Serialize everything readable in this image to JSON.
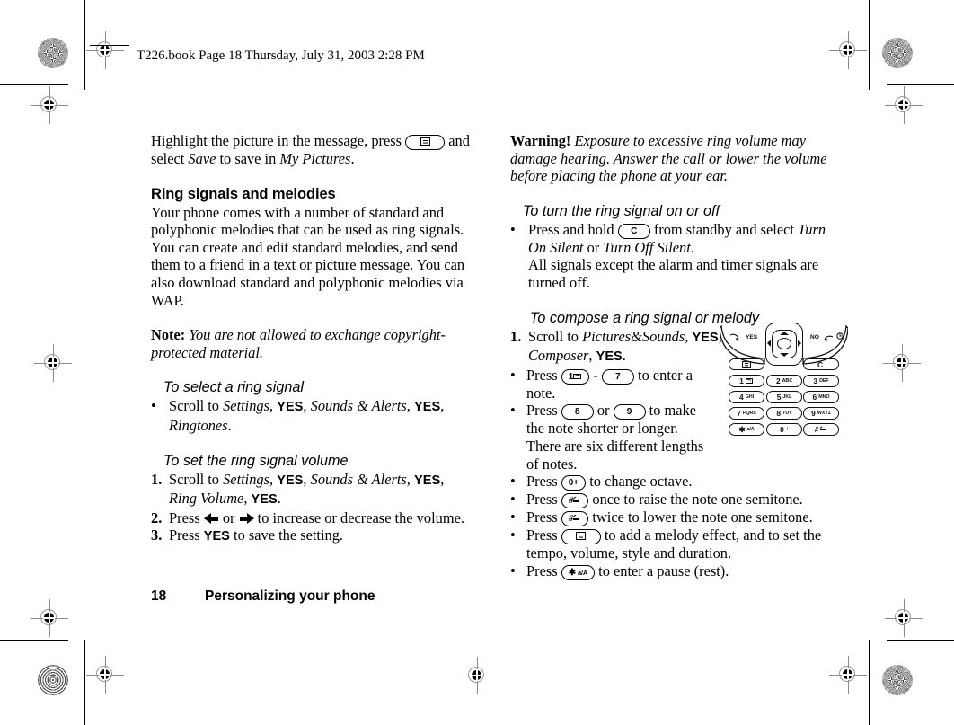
{
  "slug": {
    "text": "T226.book  Page 18  Thursday, July 31, 2003  2:28 PM"
  },
  "footer": {
    "page_number": "18",
    "chapter": "Personalizing your phone"
  },
  "left_column": {
    "intro": {
      "line1_a": "Highlight the picture in the message, press ",
      "key": "menu-key",
      "line1_b": " and",
      "line2_a": "select ",
      "line2_italic1": "Save",
      "line2_b": " to save in ",
      "line2_italic2": "My Pictures",
      "line2_c": "."
    },
    "section_heading": "Ring signals and melodies",
    "section_body": "Your phone comes with a number of standard and polyphonic melodies that can be used as ring signals. You can create and edit standard melodies, and send them to a friend in a text or picture message. You can also download standard and polyphonic melodies via WAP.",
    "note": {
      "label": "Note:",
      "text": "You are not allowed to exchange copyright-protected material."
    },
    "sub1": {
      "heading": "To select a ring signal",
      "marker": "•",
      "parts": [
        {
          "t": "Scroll to ",
          "style": "roman"
        },
        {
          "t": "Settings",
          "style": "italic"
        },
        {
          "t": ", ",
          "style": "roman"
        },
        {
          "t": "YES",
          "style": "bold-sans"
        },
        {
          "t": ", ",
          "style": "roman"
        },
        {
          "t": "Sounds & Alerts",
          "style": "italic"
        },
        {
          "t": ", ",
          "style": "roman"
        },
        {
          "t": "YES",
          "style": "bold-sans"
        },
        {
          "t": ", ",
          "style": "roman"
        },
        {
          "t": "Ringtones",
          "style": "italic"
        },
        {
          "t": ".",
          "style": "roman"
        }
      ]
    },
    "sub2": {
      "heading": "To set the ring signal volume",
      "steps": [
        {
          "marker": "1.",
          "parts": [
            {
              "t": "Scroll to ",
              "style": "roman"
            },
            {
              "t": "Settings",
              "style": "italic"
            },
            {
              "t": ", ",
              "style": "roman"
            },
            {
              "t": "YES",
              "style": "bold-sans"
            },
            {
              "t": ", ",
              "style": "roman"
            },
            {
              "t": "Sounds & Alerts",
              "style": "italic"
            },
            {
              "t": ", ",
              "style": "roman"
            },
            {
              "t": "YES",
              "style": "bold-sans"
            },
            {
              "t": ", ",
              "style": "roman"
            },
            {
              "t": "Ring Volume",
              "style": "italic"
            },
            {
              "t": ", ",
              "style": "roman"
            },
            {
              "t": "YES",
              "style": "bold-sans"
            },
            {
              "t": ".",
              "style": "roman"
            }
          ]
        },
        {
          "marker": "2.",
          "text_before": "Press ",
          "arrow_left": "left-arrow",
          "text_mid": " or ",
          "arrow_right": "right-arrow",
          "text_after": " to increase or decrease the volume."
        },
        {
          "marker": "3.",
          "text_before": "Press ",
          "emph": "YES",
          "text_after": " to save the setting."
        }
      ]
    }
  },
  "right_column": {
    "warning": {
      "label": "Warning!",
      "text": "Exposure to excessive ring volume may damage hearing. Answer the call or lower the volume before placing the phone at your ear."
    },
    "sub1": {
      "heading": "To turn the ring signal on or off",
      "marker": "•",
      "line1_a": "Press and hold ",
      "key": "clear-key",
      "line1_b": " from standby and select ",
      "line1_it1": "Turn On Silent",
      "line1_c": " or ",
      "line1_it2": "Turn Off Silent",
      "line1_d": ".",
      "line2": "All signals except the alarm and timer signals are turned off."
    },
    "sub2": {
      "heading": "To compose a ring signal or melody",
      "step1": {
        "marker": "1.",
        "parts": [
          {
            "t": "Scroll to ",
            "style": "roman"
          },
          {
            "t": "Pictures&Sounds",
            "style": "italic"
          },
          {
            "t": ", ",
            "style": "roman"
          },
          {
            "t": "YES",
            "style": "bold-sans"
          },
          {
            "t": ", ",
            "style": "roman"
          },
          {
            "t": "Composer",
            "style": "italic"
          },
          {
            "t": ", ",
            "style": "roman"
          },
          {
            "t": "YES",
            "style": "bold-sans"
          },
          {
            "t": ".",
            "style": "roman"
          }
        ]
      },
      "bullets": [
        {
          "marker": "•",
          "before": "Press ",
          "key1": "1",
          "mid": " - ",
          "key2": "7",
          "after": " to enter a note."
        },
        {
          "marker": "•",
          "before": "Press ",
          "key1": "8",
          "mid": " or ",
          "key2": "9",
          "after": " to make the note shorter or longer. There are six different lengths of notes."
        },
        {
          "marker": "•",
          "before": "Press ",
          "key1": "0+",
          "after": " to change octave."
        },
        {
          "marker": "•",
          "before": "Press ",
          "key1": "#",
          "after": " once to raise the note one semitone."
        },
        {
          "marker": "•",
          "before": "Press ",
          "key1": "#",
          "after": " twice to lower the note one semitone."
        },
        {
          "marker": "•",
          "before": "Press ",
          "key1": "menu",
          "after": " to add a melody effect, and to set the tempo, volume, style and duration."
        },
        {
          "marker": "•",
          "before": "Press ",
          "key1": "*a/A",
          "after": " to enter a pause (rest)."
        }
      ]
    }
  },
  "keypad_illustration": {
    "soft_left_label": "YES",
    "soft_right_label": "NO",
    "row_top": [
      {
        "num": "menu",
        "letters": ""
      },
      {
        "num": "C",
        "letters": ""
      }
    ],
    "keys": [
      {
        "num": "1",
        "letters": "voicemail"
      },
      {
        "num": "2",
        "letters": "ABC"
      },
      {
        "num": "3",
        "letters": "DEF"
      },
      {
        "num": "4",
        "letters": "GHI"
      },
      {
        "num": "5",
        "letters": "JKL"
      },
      {
        "num": "6",
        "letters": "MNO"
      },
      {
        "num": "7",
        "letters": "PQRS"
      },
      {
        "num": "8",
        "letters": "TUV"
      },
      {
        "num": "9",
        "letters": "WXYZ"
      },
      {
        "num": "*",
        "letters": "a/A"
      },
      {
        "num": "0",
        "letters": "+"
      },
      {
        "num": "#",
        "letters": "space"
      }
    ]
  },
  "colors": {
    "ink": "#000000",
    "registration_gray": "#8a8a8a",
    "paper": "#ffffff"
  }
}
